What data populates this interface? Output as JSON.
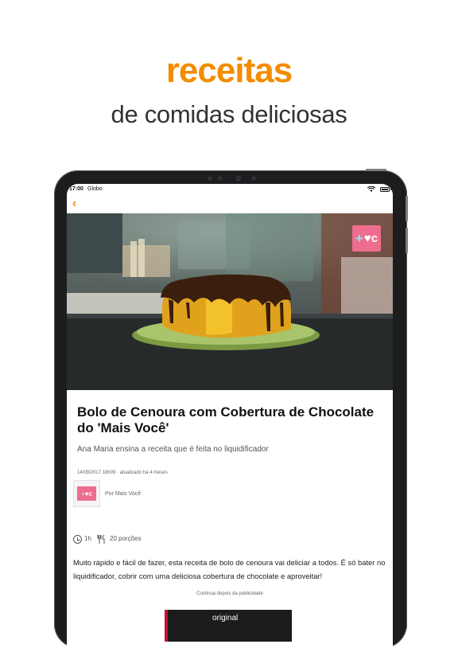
{
  "promo": {
    "headline": "receitas",
    "subheadline": "de comidas deliciosas"
  },
  "status_bar": {
    "time": "17:00",
    "carrier": "Globo",
    "wifi_icon": "wifi-icon",
    "battery_icon": "battery-icon"
  },
  "nav": {
    "back_icon": "chevron-left-icon",
    "back_glyph": "‹"
  },
  "brand": {
    "badge_plus": "+",
    "badge_text": "♥c",
    "accent_color": "#f28c00",
    "badge_color": "#ee6d8f"
  },
  "article": {
    "title": "Bolo de Cenoura com Cobertura de Chocolate do 'Mais Você'",
    "subtitle": "Ana Maria ensina a receita que é feita no liquidificador",
    "date": "14/09/2017 18h09 · atualizado há 4 meses",
    "author": "Por Mais Você",
    "time": "1h",
    "servings": "20 porções",
    "body": "Muito rápido e fácil de fazer, esta receita de bolo de cenoura vai deliciar a todos. É só bater no liquidificador, cobrir com uma deliciosa cobertura de chocolate e aproveitar!",
    "ad_note": "Continua depois da publicidade",
    "ad_label": "original"
  }
}
